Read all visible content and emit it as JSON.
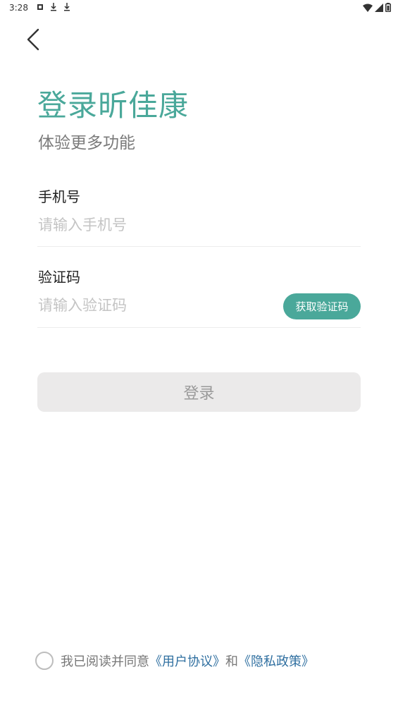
{
  "status_bar": {
    "time": "3:28",
    "left_icons": [
      "notification-icon",
      "download-icon",
      "download-icon"
    ],
    "right_icons": [
      "wifi-icon",
      "signal-icon",
      "battery-icon"
    ]
  },
  "back": {
    "icon": "chevron-left-icon"
  },
  "header": {
    "title": "登录昕佳康",
    "subtitle": "体验更多功能"
  },
  "phone": {
    "label": "手机号",
    "placeholder": "请输入手机号",
    "value": ""
  },
  "code": {
    "label": "验证码",
    "placeholder": "请输入验证码",
    "value": "",
    "button_label": "获取验证码"
  },
  "login": {
    "label": "登录"
  },
  "agreement": {
    "checked": false,
    "prefix": "我已阅读并同意",
    "user_agreement": "《用户协议》",
    "conjunction": "和",
    "privacy_policy": "《隐私政策》"
  },
  "colors": {
    "accent": "#4aa89a",
    "link": "#2f6fa0",
    "disabled_button_bg": "#ebeaea"
  }
}
